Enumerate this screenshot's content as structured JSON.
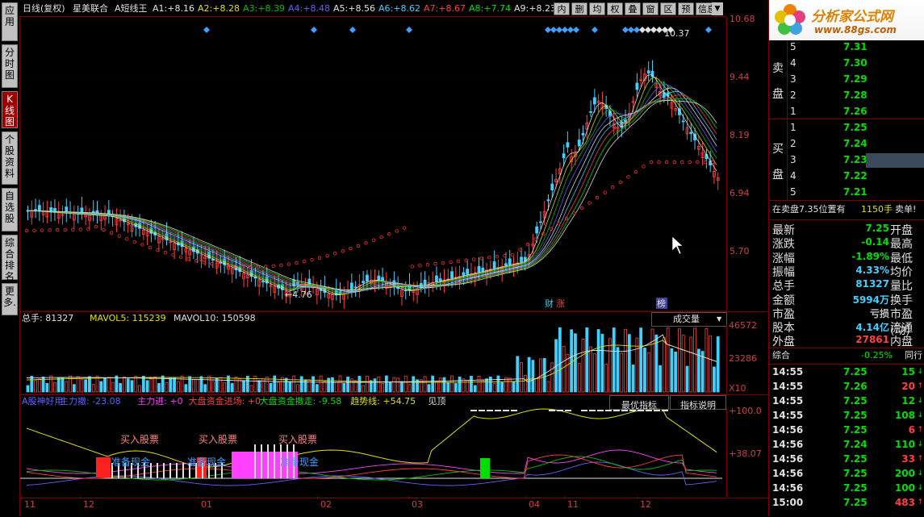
{
  "sidebar": {
    "tabs": [
      {
        "label": "应用",
        "active": false
      },
      {
        "label": "分时图",
        "active": false
      },
      {
        "label": "K线图",
        "active": true
      },
      {
        "label": "个股资料",
        "active": false
      },
      {
        "label": "自选股",
        "active": false
      },
      {
        "label": "综合排名",
        "active": false
      },
      {
        "label": "更多.",
        "active": false
      }
    ]
  },
  "header": {
    "period": "日线(复权)",
    "stock_name": "星美联合",
    "indicator_name": "A短线王",
    "ma_values": [
      {
        "label": "A1:",
        "value": "+8.16",
        "color": "#e0e0e0"
      },
      {
        "label": "A2:",
        "value": "+8.28",
        "color": "#e0e000"
      },
      {
        "label": "A3:",
        "value": "+8.39",
        "color": "#00c000"
      },
      {
        "label": "A4:",
        "value": "+8.48",
        "color": "#6060ff"
      },
      {
        "label": "A5:",
        "value": "+8.56",
        "color": "#e0e0e0"
      },
      {
        "label": "A6:",
        "value": "+8.62",
        "color": "#40d0ff"
      },
      {
        "label": "A7:",
        "value": "+8.67",
        "color": "#ff4040"
      },
      {
        "label": "A8:",
        "value": "+7.74",
        "color": "#00e000"
      },
      {
        "label": "A9:",
        "value": "+8.23",
        "color": "#e0e0e0"
      }
    ],
    "toolbar": [
      "内",
      "删",
      "均",
      "权",
      "叠",
      "窗",
      "区",
      "预",
      "信息"
    ]
  },
  "price_axis": [
    "10.68",
    "9.44",
    "8.19",
    "6.94",
    "5.70"
  ],
  "annotations": {
    "high": "10.37",
    "low": "4.76",
    "tag_cai": "财",
    "tag_zhang": "涨",
    "tag_bang": "榜"
  },
  "volume_panel": {
    "header_total": "总手: 81327",
    "header_mavol5": "MAVOL5: 115239",
    "header_mavol10": "MAVOL10: 150598",
    "dropdown": "成交量",
    "axis": [
      "46572",
      "23286"
    ],
    "unit": "X10"
  },
  "indicator_panel": {
    "header": [
      {
        "text": "A股神好用",
        "color": "#6060ff"
      },
      {
        "text": "主力撤: -23.08",
        "color": "#6060ff"
      },
      {
        "text": "主力进: +0",
        "color": "#ff40ff"
      },
      {
        "text": "大盘资金进场: +0",
        "color": "#ff4040"
      },
      {
        "text": "大盘资金撤走: -9.58",
        "color": "#00e000"
      },
      {
        "text": "趋势线: +54.75",
        "color": "#e0e000"
      },
      {
        "text": "见顶",
        "color": "#e0e0e0"
      }
    ],
    "buttons": [
      "最优指标",
      "指标说明"
    ],
    "axis": [
      "+100.0",
      "+38.07"
    ],
    "buy_labels": [
      "买入股票",
      "买入股票",
      "买入股票"
    ],
    "cash_labels": [
      "准备现金",
      "准备现金",
      "准备现金"
    ]
  },
  "date_axis": [
    "11",
    "12",
    "01",
    "02",
    "03",
    "04",
    "11",
    "12"
  ],
  "right_panel": {
    "logo_title": "分析家公式网",
    "logo_url": "www.88gs.com",
    "sell_label_top": "卖",
    "sell_label_bottom": "盘",
    "buy_label_top": "买",
    "buy_label_bottom": "盘",
    "sell_orders": [
      {
        "level": "5",
        "price": "7.31"
      },
      {
        "level": "4",
        "price": "7.30"
      },
      {
        "level": "3",
        "price": "7.29"
      },
      {
        "level": "2",
        "price": "7.28"
      },
      {
        "level": "1",
        "price": "7.26"
      }
    ],
    "buy_orders": [
      {
        "level": "1",
        "price": "7.25"
      },
      {
        "level": "2",
        "price": "7.24"
      },
      {
        "level": "3",
        "price": "7.23"
      },
      {
        "level": "4",
        "price": "7.22"
      },
      {
        "level": "5",
        "price": "7.21"
      }
    ],
    "notice_left": "在卖盘7.35位置有",
    "notice_mid": "1150手",
    "notice_right": "卖单!",
    "stats": [
      {
        "label": "最新",
        "value": "7.25",
        "label2": "开盘",
        "vcolor": "#00e000"
      },
      {
        "label": "涨跌",
        "value": "-0.14",
        "label2": "最高",
        "vcolor": "#00e000"
      },
      {
        "label": "涨幅",
        "value": "-1.89%",
        "label2": "最低",
        "vcolor": "#00e000"
      },
      {
        "label": "振幅",
        "value": "4.33%",
        "label2": "均价",
        "vcolor": "#40d0ff"
      },
      {
        "label": "总手",
        "value": "81327",
        "label2": "量比",
        "vcolor": "#40d0ff"
      },
      {
        "label": "金额",
        "value": "5994万",
        "label2": "换手",
        "vcolor": "#40d0ff"
      },
      {
        "label": "市盈",
        "value": "亏损",
        "label2": "市盈(动)",
        "vcolor": "#c0c0c0"
      },
      {
        "label": "股本",
        "value": "4.14亿",
        "label2": "流通",
        "vcolor": "#40d0ff"
      },
      {
        "label": "外盘",
        "value": "27861",
        "label2": "内盘",
        "vcolor": "#ff4040"
      }
    ],
    "summary_left": "综合",
    "summary_mid": "-0.25%",
    "summary_right": "同行",
    "trades": [
      {
        "time": "14:55",
        "price": "7.25",
        "vol": "15"
      },
      {
        "time": "14:55",
        "price": "7.26",
        "vol": "20"
      },
      {
        "time": "14:55",
        "price": "7.25",
        "vol": "12"
      },
      {
        "time": "14:55",
        "price": "7.25",
        "vol": "108"
      },
      {
        "time": "14:56",
        "price": "7.25",
        "vol": "6"
      },
      {
        "time": "14:56",
        "price": "7.24",
        "vol": "110"
      },
      {
        "time": "14:56",
        "price": "7.25",
        "vol": "33"
      },
      {
        "time": "14:56",
        "price": "7.25",
        "vol": "200"
      },
      {
        "time": "14:56",
        "price": "7.25",
        "vol": "100"
      },
      {
        "time": "15:00",
        "price": "7.25",
        "vol": "483"
      }
    ]
  }
}
